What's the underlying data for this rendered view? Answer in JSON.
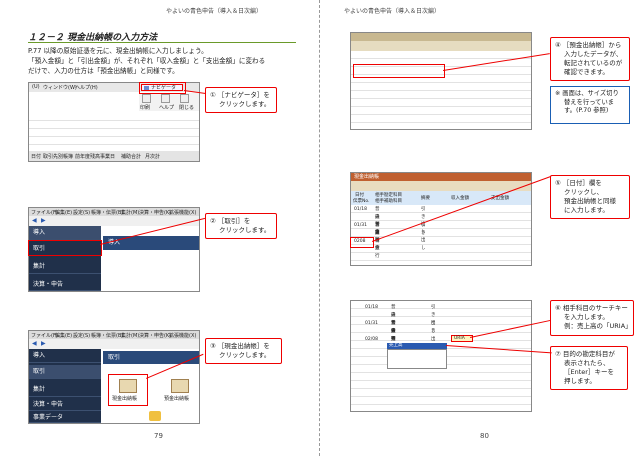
{
  "left_page": {
    "header": "やよいの青色申告（導入＆日次編）",
    "page_number": "79",
    "section_title": "１２－２ 現金出納帳の入力方法",
    "body": [
      "P.77 以降の原始証憑を元に、現金出納帳に入力しましょう。",
      "「預入金額」と「引出金額」が、それぞれ「収入金額」と「支出金額」に変わる",
      "だけで、入力の仕方は「預金出納帳」と同様です。"
    ],
    "shot1": {
      "menu_items": [
        "(U)",
        "ウィンドウ(W)",
        "ヘルプ(H)"
      ],
      "navigator_button": "ナビゲータ",
      "tool_labels": [
        "印刷",
        "ヘルプ",
        "閉じる"
      ],
      "bottom_tabs": [
        "日付",
        "取引先別帳簿",
        "前年度残高事業日",
        "補助合計",
        "月次計"
      ]
    },
    "shot2": {
      "menu_items": [
        "ファイル(F)",
        "編集(E)",
        "設定(S)",
        "帳簿・伝票(B)",
        "集計(M)",
        "決算・申告(K)",
        "拡張機能(X)"
      ],
      "nav_items": [
        "導入",
        "取引",
        "集計",
        "決算・申告"
      ],
      "pane_title": "導入"
    },
    "shot3": {
      "menu_items": [
        "ファイル(F)",
        "編集(E)",
        "設定(S)",
        "帳簿・伝票(B)",
        "集計(M)",
        "決算・申告(K)",
        "拡張機能(X)"
      ],
      "nav_items": [
        "導入",
        "取引",
        "集計",
        "決算・申告",
        "事業データ"
      ],
      "pane_title": "取引",
      "icons": [
        "現金出納帳",
        "預金出納帳"
      ]
    },
    "callouts": [
      {
        "num": "①",
        "text": [
          "［ナビゲータ］を",
          "クリックします。"
        ]
      },
      {
        "num": "②",
        "text": [
          "［取引］を",
          "クリックします。"
        ]
      },
      {
        "num": "③",
        "text": [
          "［現金出納帳］を",
          "クリックします。"
        ]
      }
    ]
  },
  "right_page": {
    "header": "やよいの青色申告（導入＆日次編）",
    "page_number": "80",
    "callouts": [
      {
        "num": "④",
        "text": [
          "［預金出納帳］から",
          "入力したデータが、",
          "転記されているのが",
          "確認できます。"
        ]
      },
      {
        "num": "⑤",
        "text": [
          "［日付］欄を",
          "クリックし、",
          "預金出納帳と同様",
          "に入力します。"
        ]
      },
      {
        "num": "⑥",
        "text": [
          "相手科目のサーチキー",
          "を入力します。",
          "例：売上高の「URIA」"
        ]
      },
      {
        "num": "⑦",
        "text": [
          "目的の勘定科目が",
          "表示されたら、",
          "［Enter］キーを",
          "押します。"
        ]
      }
    ],
    "note": {
      "mark": "※",
      "text": [
        "画面は、サイズ切り",
        "替えを行っていま",
        "す。(P.70 参照)"
      ]
    },
    "shot5": {
      "title": "現金出納帳",
      "headers": [
        "日付",
        "伝票No.",
        "相手勘定科目",
        "相手補助科目",
        "摘要",
        "収入金額",
        "支出金額"
      ],
      "rows": [
        [
          "01/18",
          "",
          "普通預金",
          "",
          "引き出し"
        ],
        [
          "",
          "",
          "白青銀行",
          "",
          ""
        ],
        [
          "01/31",
          "",
          "普通預金",
          "",
          "引き出し"
        ],
        [
          "",
          "",
          "白青銀行",
          "",
          ""
        ],
        [
          "0208",
          "",
          "",
          "",
          ""
        ]
      ]
    },
    "shot6": {
      "rows": [
        [
          "01/18",
          "普通預金",
          "引き出し"
        ],
        [
          "",
          "白青銀行",
          ""
        ],
        [
          "01/31",
          "普通預金",
          "引き出し"
        ],
        [
          "",
          "白青銀行",
          ""
        ],
        [
          "02/08",
          "売上高",
          ""
        ]
      ],
      "search_key": "URIA",
      "dropdown_item": "売上高"
    }
  }
}
